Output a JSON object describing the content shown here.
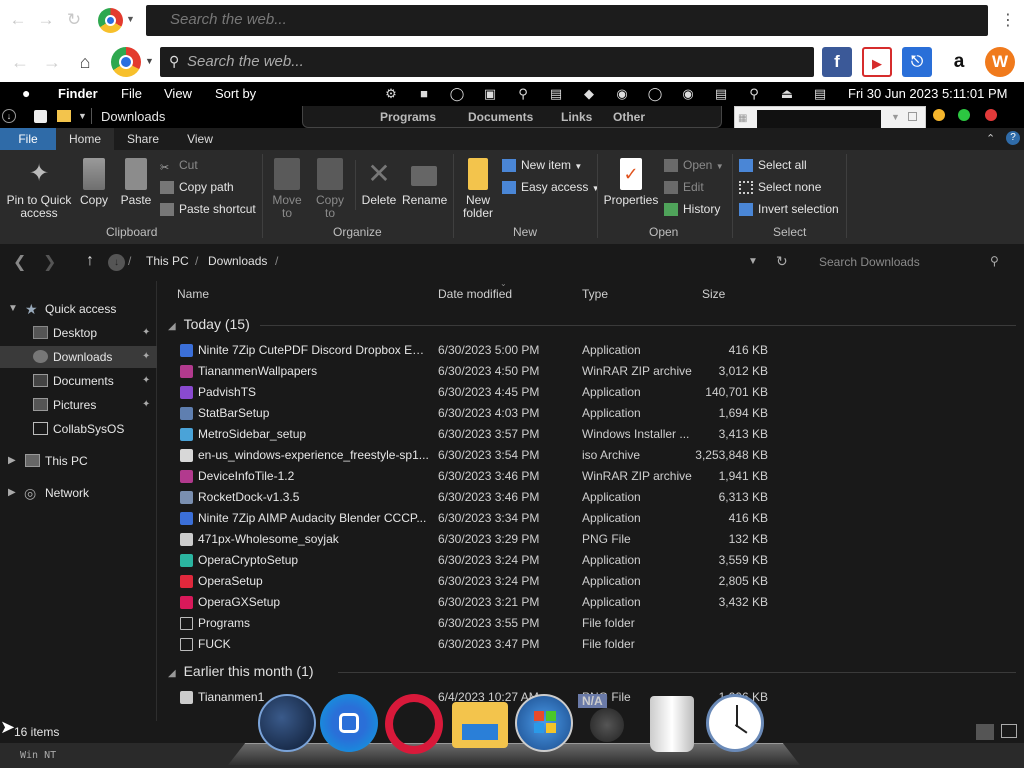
{
  "browser_top": {
    "search_placeholder": "Search the web..."
  },
  "browser": {
    "search_placeholder": "Search the web...",
    "quicklinks": [
      "facebook-icon",
      "youtube-icon",
      "game-controller-icon",
      "amazon-icon",
      "w-icon"
    ]
  },
  "menubar": {
    "apple": "",
    "app": "Finder",
    "items": [
      "File",
      "View",
      "Sort by"
    ],
    "clock": "Fri 30 Jun 2023  5:11:01 PM"
  },
  "window": {
    "title": "Downloads",
    "stacks": [
      "Programs",
      "Documents",
      "Links",
      "Other"
    ]
  },
  "ribbon": {
    "tabs": [
      "File",
      "Home",
      "Share",
      "View"
    ],
    "pin_label": "Pin to Quick access",
    "copy_label": "Copy",
    "paste_label": "Paste",
    "cut_label": "Cut",
    "copy_path_label": "Copy path",
    "paste_shortcut_label": "Paste shortcut",
    "move_to_label": "Move to",
    "copy_to_label": "Copy to",
    "delete_label": "Delete",
    "rename_label": "Rename",
    "new_folder_label": "New folder",
    "new_item_label": "New item",
    "easy_access_label": "Easy access",
    "properties_label": "Properties",
    "open_label": "Open",
    "edit_label": "Edit",
    "history_label": "History",
    "select_all_label": "Select all",
    "select_none_label": "Select none",
    "invert_selection_label": "Invert selection",
    "groups": [
      "Clipboard",
      "Organize",
      "New",
      "Open",
      "Select"
    ]
  },
  "address": {
    "crumbs": [
      "This PC",
      "Downloads"
    ],
    "search_placeholder": "Search Downloads"
  },
  "nav": {
    "quick_access": "Quick access",
    "items": [
      "Desktop",
      "Downloads",
      "Documents",
      "Pictures",
      "CollabSysOS"
    ],
    "this_pc": "This PC",
    "network": "Network"
  },
  "columns": {
    "name": "Name",
    "date": "Date modified",
    "type": "Type",
    "size": "Size"
  },
  "groups": [
    {
      "label": "Today (15)"
    },
    {
      "label": "Earlier this month (1)"
    }
  ],
  "files": [
    {
      "name": "Ninite 7Zip CutePDF Discord Dropbox Ecl...",
      "date": "6/30/2023 5:00 PM",
      "type": "Application",
      "size": "416 KB",
      "icon_color": "#3b6fd8"
    },
    {
      "name": "TiananmenWallpapers",
      "date": "6/30/2023 4:50 PM",
      "type": "WinRAR ZIP archive",
      "size": "3,012 KB",
      "icon_color": "#b23a8e"
    },
    {
      "name": "PadvishTS",
      "date": "6/30/2023 4:45 PM",
      "type": "Application",
      "size": "140,701 KB",
      "icon_color": "#8a4ad0"
    },
    {
      "name": "StatBarSetup",
      "date": "6/30/2023 4:03 PM",
      "type": "Application",
      "size": "1,694 KB",
      "icon_color": "#5f7fb0"
    },
    {
      "name": "MetroSidebar_setup",
      "date": "6/30/2023 3:57 PM",
      "type": "Windows Installer ...",
      "size": "3,413 KB",
      "icon_color": "#4aa3d8"
    },
    {
      "name": "en-us_windows-experience_freestyle-sp1...",
      "date": "6/30/2023 3:54 PM",
      "type": "iso Archive",
      "size": "3,253,848 KB",
      "icon_color": "#d8d8d8"
    },
    {
      "name": "DeviceInfoTile-1.2",
      "date": "6/30/2023 3:46 PM",
      "type": "WinRAR ZIP archive",
      "size": "1,941 KB",
      "icon_color": "#b23a8e"
    },
    {
      "name": "RocketDock-v1.3.5",
      "date": "6/30/2023 3:46 PM",
      "type": "Application",
      "size": "6,313 KB",
      "icon_color": "#7a8fb0"
    },
    {
      "name": "Ninite 7Zip AIMP Audacity Blender CCCP...",
      "date": "6/30/2023 3:34 PM",
      "type": "Application",
      "size": "416 KB",
      "icon_color": "#3b6fd8"
    },
    {
      "name": "471px-Wholesome_soyjak",
      "date": "6/30/2023 3:29 PM",
      "type": "PNG File",
      "size": "132 KB",
      "icon_color": "#cccccc"
    },
    {
      "name": "OperaCryptoSetup",
      "date": "6/30/2023 3:24 PM",
      "type": "Application",
      "size": "3,559 KB",
      "icon_color": "#2bb5a0"
    },
    {
      "name": "OperaSetup",
      "date": "6/30/2023 3:24 PM",
      "type": "Application",
      "size": "2,805 KB",
      "icon_color": "#e0283c"
    },
    {
      "name": "OperaGXSetup",
      "date": "6/30/2023 3:21 PM",
      "type": "Application",
      "size": "3,432 KB",
      "icon_color": "#d8195a"
    },
    {
      "name": "Programs",
      "date": "6/30/2023 3:55 PM",
      "type": "File folder",
      "size": "",
      "icon_color": "#191919"
    },
    {
      "name": "FUCK",
      "date": "6/30/2023 3:47 PM",
      "type": "File folder",
      "size": "",
      "icon_color": "#191919"
    },
    {
      "name": "Tiananmen1",
      "date": "6/4/2023 10:27 AM",
      "type": "PNG File",
      "size": "1,206 KB",
      "icon_color": "#cccccc"
    }
  ],
  "status": {
    "count": "16 items"
  },
  "dock": {
    "apps": [
      "steam-icon",
      "app-icon",
      "opera-icon",
      "explorer-icon",
      "windows-icon",
      "na-icon",
      "trash-icon",
      "clock-icon"
    ],
    "na_label": "N/A"
  }
}
